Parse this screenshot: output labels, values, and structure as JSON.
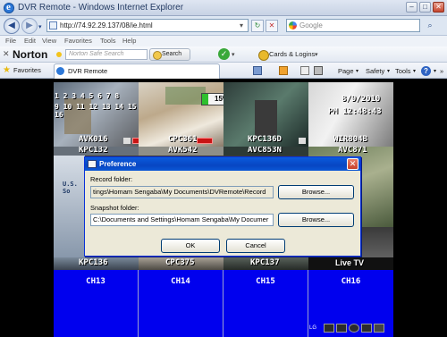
{
  "window": {
    "title": "DVR Remote - Windows Internet Explorer"
  },
  "toolbar": {
    "address": "http://74.92.29.137/08/ie.html",
    "search_placeholder": "Google"
  },
  "menu": [
    "File",
    "Edit",
    "View",
    "Favorites",
    "Tools",
    "Help"
  ],
  "norton": {
    "logo": "Norton",
    "search_placeholder": "Norton Safe Search",
    "search_button": "Search",
    "cards_label": "Cards & Logins"
  },
  "favorites_bar": {
    "favorites_label": "Favorites",
    "tab_title": "DVR Remote",
    "page_label": "Page",
    "safety_label": "Safety",
    "tools_label": "Tools"
  },
  "cameras": {
    "row1_digits_top": "1 2 3 4 5 6 7 8",
    "row1_digits_bottom": "9 10 11 12 13 14 15 16",
    "progress_text": "15%",
    "date": "8/9/2010",
    "time": "PM 12:48:43",
    "labels_row1": [
      "AVK016",
      "CPC361",
      "KPC136D",
      "WIR804B"
    ],
    "labels_row2": [
      "KPC132",
      "AVK542",
      "AVC853N",
      "AVC871"
    ],
    "labels_row3": [
      "KPC136",
      "CPC375",
      "KPC137",
      "Live TV"
    ],
    "blue_channels": [
      "CH13",
      "CH14",
      "CH15",
      "CH16"
    ],
    "side_text": "U.S. So"
  },
  "dialog": {
    "title": "Preference",
    "record_label": "Record folder:",
    "record_value": "tings\\Homam Sengaba\\My Documents\\DVRemote\\Record",
    "snapshot_label": "Snapshot folder:",
    "snapshot_value": "C:\\Documents and Settings\\Homam Sengaba\\My Documer",
    "browse_label": "Browse...",
    "ok_label": "OK",
    "cancel_label": "Cancel"
  },
  "tray": {
    "lg_label": "LG"
  },
  "colors": {
    "channel_blue": "#0000ee",
    "rec_red": "#c81414",
    "title_blue": "#0846c2"
  }
}
